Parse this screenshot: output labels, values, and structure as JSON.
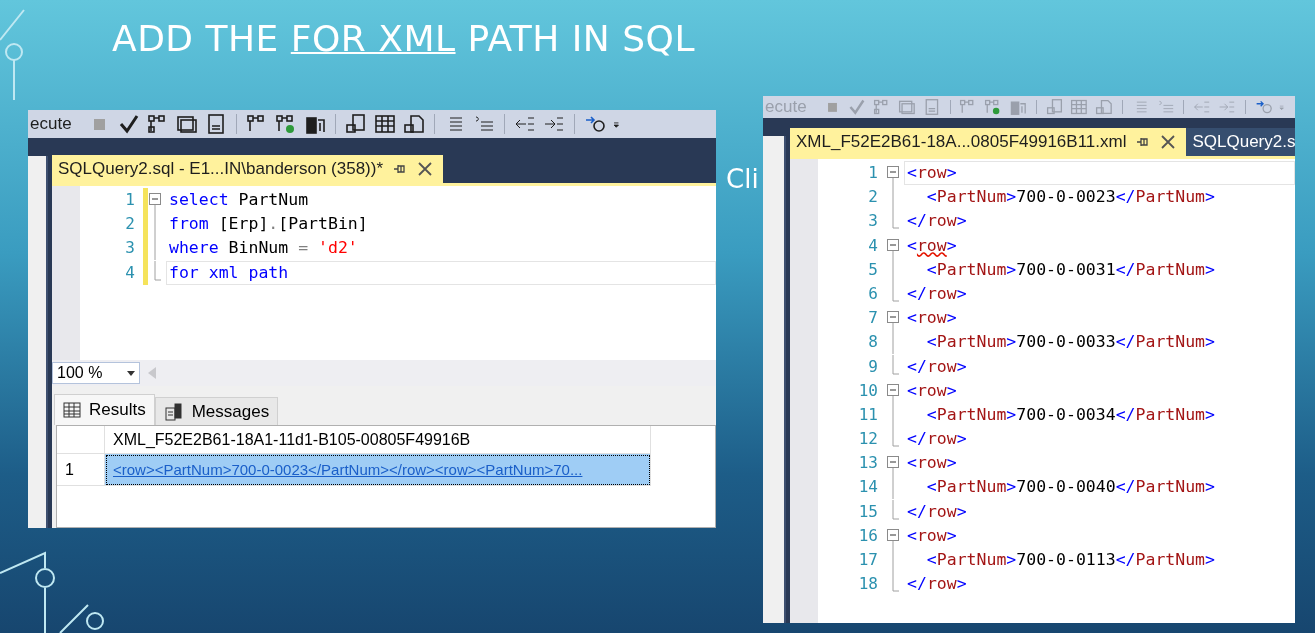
{
  "slide": {
    "title": {
      "before": "ADD THE ",
      "link": "FOR XML",
      "after": " PATH IN SQL"
    },
    "background_text": "Cli"
  },
  "query_window": {
    "toolbar_label": "ecute",
    "tab": {
      "title": "SQLQuery2.sql - E1...IN\\banderson (358))*",
      "selected": true
    },
    "lines": [
      {
        "number": "1",
        "collapsible": true,
        "current": false,
        "tokens": [
          {
            "kind": "keyword",
            "text": "select"
          },
          {
            "kind": "plain",
            "text": " PartNum"
          }
        ]
      },
      {
        "number": "2",
        "collapsible": false,
        "current": false,
        "tokens": [
          {
            "kind": "keyword",
            "text": "from"
          },
          {
            "kind": "plain",
            "text": " [Erp]"
          },
          {
            "kind": "punct",
            "text": "."
          },
          {
            "kind": "plain",
            "text": "[PartBin]"
          }
        ]
      },
      {
        "number": "3",
        "collapsible": false,
        "current": false,
        "tokens": [
          {
            "kind": "keyword",
            "text": "where"
          },
          {
            "kind": "plain",
            "text": " BinNum "
          },
          {
            "kind": "punct",
            "text": "= "
          },
          {
            "kind": "string",
            "text": "'d2'"
          }
        ]
      },
      {
        "number": "4",
        "collapsible": false,
        "current": true,
        "tokens": [
          {
            "kind": "keyword",
            "text": "for xml path"
          }
        ]
      }
    ],
    "zoom": "100 %",
    "result_tabs": [
      {
        "label": "Results",
        "selected": true
      },
      {
        "label": "Messages",
        "selected": false
      }
    ],
    "results": {
      "column": "XML_F52E2B61-18A1-11d1-B105-00805F49916B",
      "rows": [
        {
          "number": "1",
          "value": "<row><PartNum>700-0-0023</PartNum></row><row><PartNum>70...",
          "selected": true
        }
      ]
    }
  },
  "xml_window": {
    "toolbar_label": "ecute",
    "tabs": [
      {
        "label": "XML_F52E2B61-18A...0805F49916B11.xml",
        "selected": true
      },
      {
        "label": "SQLQuery2.s",
        "selected": false
      }
    ],
    "lines": [
      {
        "number": "1",
        "collapsible": true,
        "current": true,
        "tokens": [
          {
            "kind": "bracket",
            "text": "<"
          },
          {
            "kind": "tag",
            "text": "row"
          },
          {
            "kind": "bracket",
            "text": ">"
          }
        ]
      },
      {
        "number": "2",
        "collapsible": false,
        "current": false,
        "tokens": [
          {
            "kind": "bracket",
            "text": "  <"
          },
          {
            "kind": "tag",
            "text": "PartNum"
          },
          {
            "kind": "bracket",
            "text": ">"
          },
          {
            "kind": "text",
            "text": "700-0-0023"
          },
          {
            "kind": "bracket",
            "text": "</"
          },
          {
            "kind": "tag",
            "text": "PartNum"
          },
          {
            "kind": "bracket",
            "text": ">"
          }
        ]
      },
      {
        "number": "3",
        "collapsible": false,
        "current": false,
        "tokens": [
          {
            "kind": "bracket",
            "text": "</"
          },
          {
            "kind": "tag",
            "text": "row"
          },
          {
            "kind": "bracket",
            "text": ">"
          }
        ]
      },
      {
        "number": "4",
        "collapsible": true,
        "current": false,
        "tokens": [
          {
            "kind": "bracket",
            "text": "<"
          },
          {
            "kind": "tag",
            "text": "row",
            "squiggle": true
          },
          {
            "kind": "bracket",
            "text": ">"
          }
        ]
      },
      {
        "number": "5",
        "collapsible": false,
        "current": false,
        "tokens": [
          {
            "kind": "bracket",
            "text": "  <"
          },
          {
            "kind": "tag",
            "text": "PartNum"
          },
          {
            "kind": "bracket",
            "text": ">"
          },
          {
            "kind": "text",
            "text": "700-0-0031"
          },
          {
            "kind": "bracket",
            "text": "</"
          },
          {
            "kind": "tag",
            "text": "PartNum"
          },
          {
            "kind": "bracket",
            "text": ">"
          }
        ]
      },
      {
        "number": "6",
        "collapsible": false,
        "current": false,
        "tokens": [
          {
            "kind": "bracket",
            "text": "</"
          },
          {
            "kind": "tag",
            "text": "row"
          },
          {
            "kind": "bracket",
            "text": ">"
          }
        ]
      },
      {
        "number": "7",
        "collapsible": true,
        "current": false,
        "tokens": [
          {
            "kind": "bracket",
            "text": "<"
          },
          {
            "kind": "tag",
            "text": "row"
          },
          {
            "kind": "bracket",
            "text": ">"
          }
        ]
      },
      {
        "number": "8",
        "collapsible": false,
        "current": false,
        "tokens": [
          {
            "kind": "bracket",
            "text": "  <"
          },
          {
            "kind": "tag",
            "text": "PartNum"
          },
          {
            "kind": "bracket",
            "text": ">"
          },
          {
            "kind": "text",
            "text": "700-0-0033"
          },
          {
            "kind": "bracket",
            "text": "</"
          },
          {
            "kind": "tag",
            "text": "PartNum"
          },
          {
            "kind": "bracket",
            "text": ">"
          }
        ]
      },
      {
        "number": "9",
        "collapsible": false,
        "current": false,
        "tokens": [
          {
            "kind": "bracket",
            "text": "</"
          },
          {
            "kind": "tag",
            "text": "row"
          },
          {
            "kind": "bracket",
            "text": ">"
          }
        ]
      },
      {
        "number": "10",
        "collapsible": true,
        "current": false,
        "tokens": [
          {
            "kind": "bracket",
            "text": "<"
          },
          {
            "kind": "tag",
            "text": "row"
          },
          {
            "kind": "bracket",
            "text": ">"
          }
        ]
      },
      {
        "number": "11",
        "collapsible": false,
        "current": false,
        "tokens": [
          {
            "kind": "bracket",
            "text": "  <"
          },
          {
            "kind": "tag",
            "text": "PartNum"
          },
          {
            "kind": "bracket",
            "text": ">"
          },
          {
            "kind": "text",
            "text": "700-0-0034"
          },
          {
            "kind": "bracket",
            "text": "</"
          },
          {
            "kind": "tag",
            "text": "PartNum"
          },
          {
            "kind": "bracket",
            "text": ">"
          }
        ]
      },
      {
        "number": "12",
        "collapsible": false,
        "current": false,
        "tokens": [
          {
            "kind": "bracket",
            "text": "</"
          },
          {
            "kind": "tag",
            "text": "row"
          },
          {
            "kind": "bracket",
            "text": ">"
          }
        ]
      },
      {
        "number": "13",
        "collapsible": true,
        "current": false,
        "tokens": [
          {
            "kind": "bracket",
            "text": "<"
          },
          {
            "kind": "tag",
            "text": "row"
          },
          {
            "kind": "bracket",
            "text": ">"
          }
        ]
      },
      {
        "number": "14",
        "collapsible": false,
        "current": false,
        "tokens": [
          {
            "kind": "bracket",
            "text": "  <"
          },
          {
            "kind": "tag",
            "text": "PartNum"
          },
          {
            "kind": "bracket",
            "text": ">"
          },
          {
            "kind": "text",
            "text": "700-0-0040"
          },
          {
            "kind": "bracket",
            "text": "</"
          },
          {
            "kind": "tag",
            "text": "PartNum"
          },
          {
            "kind": "bracket",
            "text": ">"
          }
        ]
      },
      {
        "number": "15",
        "collapsible": false,
        "current": false,
        "tokens": [
          {
            "kind": "bracket",
            "text": "</"
          },
          {
            "kind": "tag",
            "text": "row"
          },
          {
            "kind": "bracket",
            "text": ">"
          }
        ]
      },
      {
        "number": "16",
        "collapsible": true,
        "current": false,
        "tokens": [
          {
            "kind": "bracket",
            "text": "<"
          },
          {
            "kind": "tag",
            "text": "row"
          },
          {
            "kind": "bracket",
            "text": ">"
          }
        ]
      },
      {
        "number": "17",
        "collapsible": false,
        "current": false,
        "tokens": [
          {
            "kind": "bracket",
            "text": "  <"
          },
          {
            "kind": "tag",
            "text": "PartNum"
          },
          {
            "kind": "bracket",
            "text": ">"
          },
          {
            "kind": "text",
            "text": "700-0-0113"
          },
          {
            "kind": "bracket",
            "text": "</"
          },
          {
            "kind": "tag",
            "text": "PartNum"
          },
          {
            "kind": "bracket",
            "text": ">"
          }
        ]
      },
      {
        "number": "18",
        "collapsible": false,
        "current": false,
        "tokens": [
          {
            "kind": "bracket",
            "text": "</"
          },
          {
            "kind": "tag",
            "text": "row"
          },
          {
            "kind": "bracket",
            "text": ">"
          }
        ]
      }
    ]
  }
}
